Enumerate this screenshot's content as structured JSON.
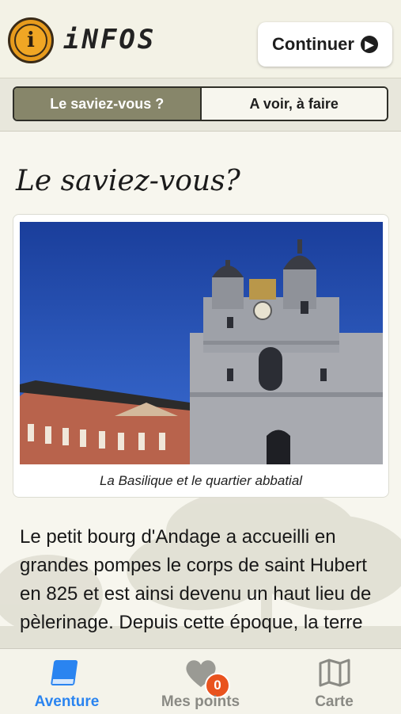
{
  "header": {
    "title": "iNFOS",
    "continue_label": "Continuer",
    "info_glyph": "i"
  },
  "segments": [
    {
      "label": "Le saviez-vous ?",
      "active": true
    },
    {
      "label": "A voir, à faire",
      "active": false
    }
  ],
  "content": {
    "section_title": "Le saviez-vous?",
    "photo_caption": "La Basilique et le quartier abbatial",
    "body": "Le petit bourg d'Andage a accueilli en grandes pompes le corps de saint Hubert en 825 et est ainsi devenu un haut lieu de pèlerinage. Depuis cette époque, la terre"
  },
  "tabs": [
    {
      "label": "Aventure",
      "icon": "book-icon",
      "active": true
    },
    {
      "label": "Mes points",
      "icon": "heart-icon",
      "badge": "0",
      "active": false
    },
    {
      "label": "Carte",
      "icon": "map-icon",
      "active": false
    }
  ],
  "colors": {
    "accent": "#2a84f0",
    "badge": "#e9531f",
    "active_segment": "#87866a"
  }
}
